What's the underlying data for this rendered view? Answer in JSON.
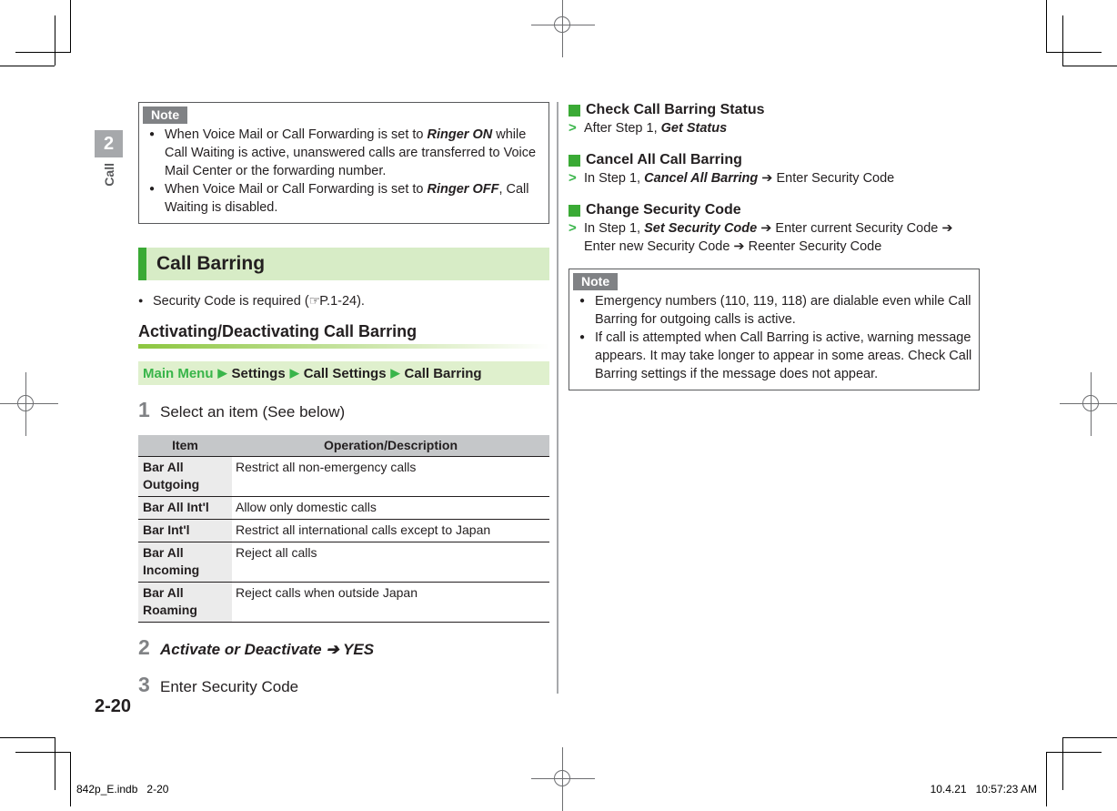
{
  "chapter": {
    "number": "2",
    "label": "Call"
  },
  "left_column": {
    "note_top": {
      "tag": "Note",
      "items": [
        {
          "parts": [
            {
              "t": "When Voice Mail or Call Forwarding is set to ",
              "b": false
            },
            {
              "t": "Ringer ON",
              "b": true
            },
            {
              "t": " while Call Waiting is active, unanswered calls are transferred to Voice Mail Center or the forwarding number.",
              "b": false
            }
          ]
        },
        {
          "parts": [
            {
              "t": "When Voice Mail or Call Forwarding is set to ",
              "b": false
            },
            {
              "t": "Ringer OFF",
              "b": true
            },
            {
              "t": ", Call Waiting is disabled.",
              "b": false
            }
          ]
        }
      ]
    },
    "section_title": "Call Barring",
    "bullet": {
      "text_before": "Security Code is required (",
      "icon": "pointing-hand-icon",
      "icon_glyph": "☞",
      "reference": "P.1-24",
      "text_after": ")."
    },
    "sub_heading": "Activating/Deactivating Call Barring",
    "nav_path": {
      "root": "Main Menu",
      "arrow": "▶",
      "items": [
        "Settings",
        "Call Settings",
        "Call Barring"
      ]
    },
    "steps": [
      {
        "n": "1",
        "text": "Select an item (See below)",
        "emph": false
      },
      {
        "n": "2",
        "text": "Activate or Deactivate ➔ YES",
        "emph": true
      },
      {
        "n": "3",
        "text": "Enter Security Code",
        "emph": false
      }
    ],
    "table": {
      "headers": [
        "Item",
        "Operation/Description"
      ],
      "rows": [
        {
          "item": "Bar All Outgoing",
          "desc": "Restrict all non-emergency calls",
          "tall": true
        },
        {
          "item": "Bar All Int'l",
          "desc": "Allow only domestic calls",
          "tall": false
        },
        {
          "item": "Bar Int'l",
          "desc": "Restrict all international calls except to Japan",
          "tall": false
        },
        {
          "item": "Bar All Incoming",
          "desc": "Reject all calls",
          "tall": true
        },
        {
          "item": "Bar All Roaming",
          "desc": "Reject calls when outside Japan",
          "tall": true
        }
      ]
    }
  },
  "right_column": {
    "sections": [
      {
        "title": "Check Call Barring Status",
        "marker": ">",
        "parts": [
          {
            "t": "After Step 1, ",
            "b": false
          },
          {
            "t": "Get Status",
            "b": true
          }
        ]
      },
      {
        "title": "Cancel All Call Barring",
        "marker": ">",
        "parts": [
          {
            "t": "In Step 1, ",
            "b": false
          },
          {
            "t": "Cancel All Barring",
            "b": true
          },
          {
            "t": " ➔ Enter Security Code",
            "b": false
          }
        ]
      },
      {
        "title": "Change Security Code",
        "marker": ">",
        "parts": [
          {
            "t": "In Step 1, ",
            "b": false
          },
          {
            "t": "Set Security Code",
            "b": true
          },
          {
            "t": " ➔ Enter current Security Code ➔ Enter new Security Code ➔ Reenter Security Code",
            "b": false
          }
        ]
      }
    ],
    "note": {
      "tag": "Note",
      "items": [
        {
          "parts": [
            {
              "t": "Emergency numbers (110, 119, 118) are dialable even while Call Barring for outgoing calls is active.",
              "b": false
            }
          ]
        },
        {
          "parts": [
            {
              "t": "If call is attempted when Call Barring is active, warning message appears. It may take longer to appear in some areas. Check Call Barring settings if the message does not appear.",
              "b": false
            }
          ]
        }
      ]
    }
  },
  "folio": "2-20",
  "footer": {
    "file": "842p_E.indb",
    "page": "2-20",
    "date": "10.4.21",
    "time": "10:57:23 AM"
  },
  "colors": {
    "accent_green": "#3aaa35",
    "light_green": "#d7ecc6",
    "path_green": "#dff0cd",
    "link_green": "#39b54a",
    "note_tag_gray": "#808285",
    "table_header_gray": "#c5c7c9",
    "table_item_gray": "#ebebeb"
  }
}
